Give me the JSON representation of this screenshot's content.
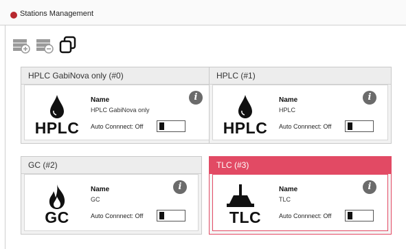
{
  "window": {
    "title": "Stations Management"
  },
  "toolbar": {
    "buttons": [
      {
        "icon": "add-station-icon"
      },
      {
        "icon": "remove-station-icon"
      },
      {
        "icon": "duplicate-station-icon"
      }
    ]
  },
  "labels": {
    "name": "Name",
    "auto_connect": "Auto Connnect: Off"
  },
  "stations": [
    {
      "header": "HPLC GabiNova only (#0)",
      "icon": "hplc-drop-icon",
      "glyph_text": "HPLC",
      "name": "HPLC GabiNova only",
      "auto_connect": false,
      "selected": false
    },
    {
      "header": "HPLC (#1)",
      "icon": "hplc-drop-icon",
      "glyph_text": "HPLC",
      "name": "HPLC",
      "auto_connect": false,
      "selected": false
    },
    {
      "header": "GC (#2)",
      "icon": "gc-flame-icon",
      "glyph_text": "GC",
      "name": "GC",
      "auto_connect": false,
      "selected": false
    },
    {
      "header": "TLC (#3)",
      "icon": "tlc-plate-icon",
      "glyph_text": "TLC",
      "name": "TLC",
      "auto_connect": false,
      "selected": true
    }
  ],
  "colors": {
    "selected_accent": "#e24a64",
    "title_dot": "#b8282f"
  }
}
